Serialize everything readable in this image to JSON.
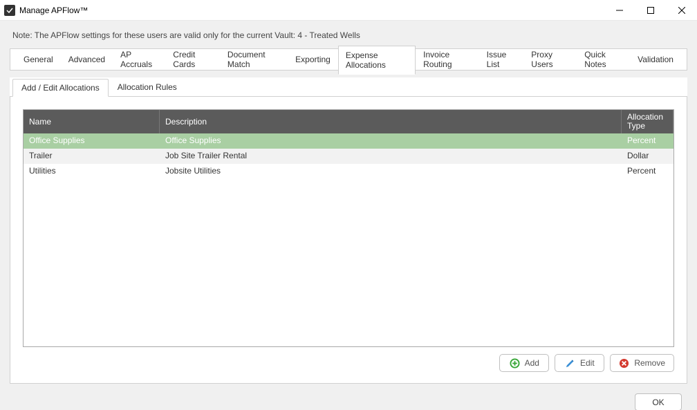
{
  "window": {
    "title": "Manage APFlow™"
  },
  "note": "Note:  The APFlow settings for these users are valid only for the current Vault: 4 - Treated Wells",
  "mainTabs": [
    {
      "label": "General"
    },
    {
      "label": "Advanced"
    },
    {
      "label": "AP Accruals"
    },
    {
      "label": "Credit Cards"
    },
    {
      "label": "Document Match"
    },
    {
      "label": "Exporting"
    },
    {
      "label": "Expense Allocations",
      "active": true
    },
    {
      "label": "Invoice Routing"
    },
    {
      "label": "Issue List"
    },
    {
      "label": "Proxy Users"
    },
    {
      "label": "Quick Notes"
    },
    {
      "label": "Validation"
    }
  ],
  "subTabs": [
    {
      "label": "Add / Edit Allocations",
      "active": true
    },
    {
      "label": "Allocation Rules"
    }
  ],
  "grid": {
    "columns": {
      "name": "Name",
      "description": "Description",
      "type": "Allocation Type"
    },
    "rows": [
      {
        "name": "Office Supplies",
        "description": "Office Supplies",
        "type": "Percent",
        "selected": true
      },
      {
        "name": "Trailer",
        "description": "Job Site Trailer Rental",
        "type": "Dollar",
        "alt": true
      },
      {
        "name": "Utilities",
        "description": "Jobsite Utilities",
        "type": "Percent"
      }
    ]
  },
  "buttons": {
    "add": "Add",
    "edit": "Edit",
    "remove": "Remove",
    "ok": "OK"
  }
}
